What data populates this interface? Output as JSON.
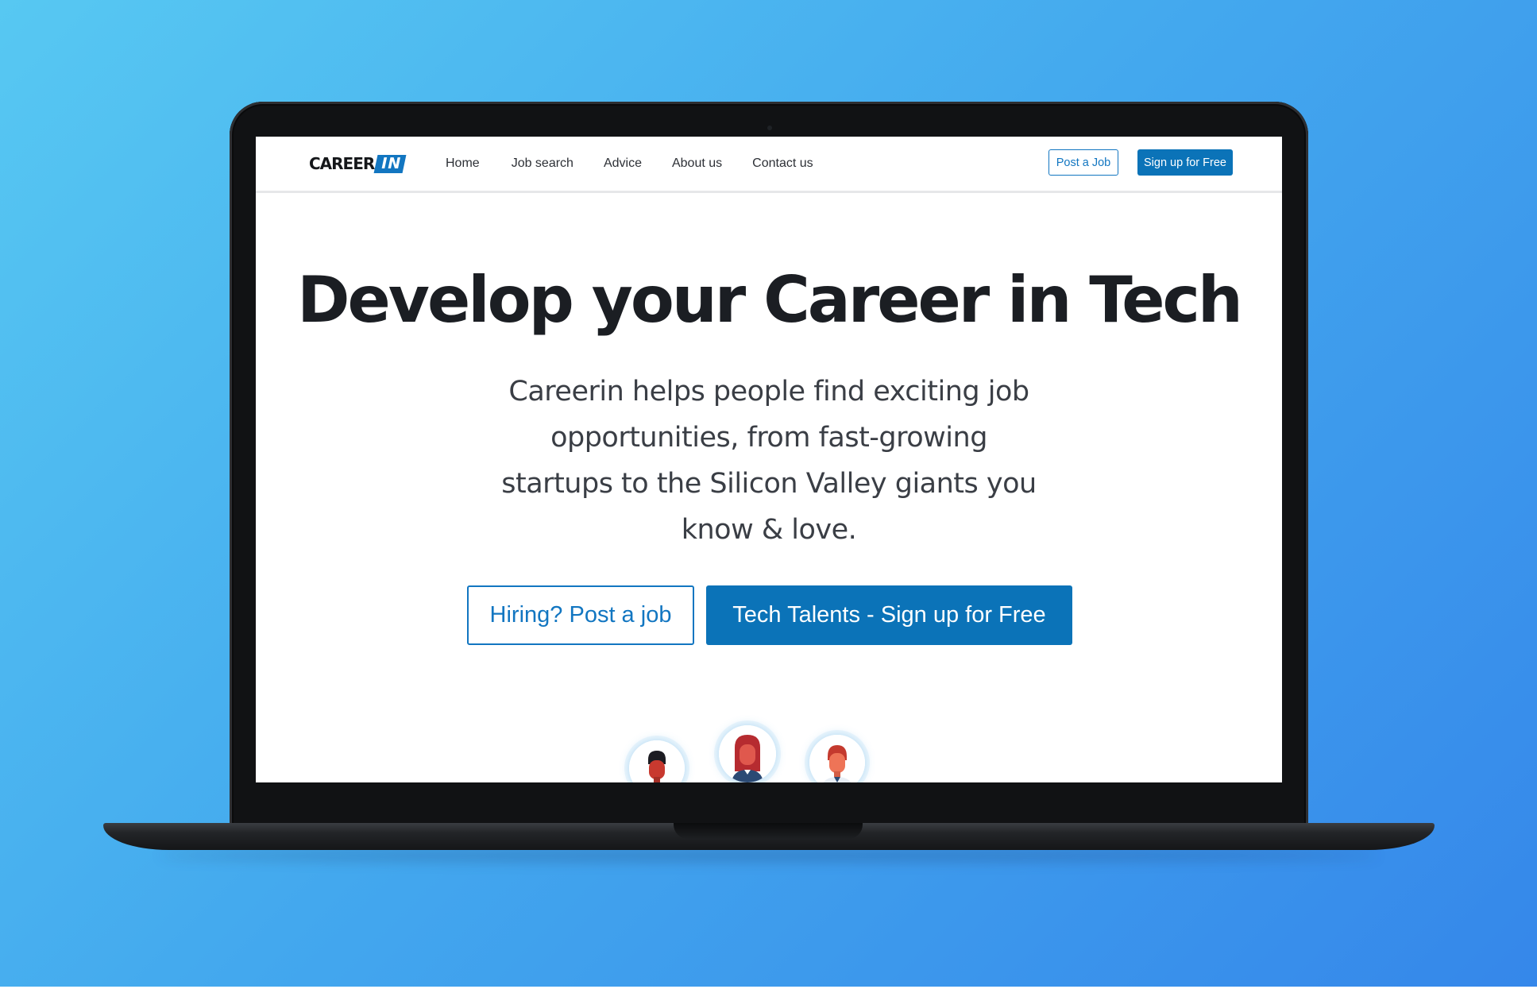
{
  "nav": {
    "logo_text": "CAREER",
    "logo_badge": "IN",
    "links": [
      "Home",
      "Job search",
      "Advice",
      "About us",
      "Contact us"
    ],
    "post_job_label": "Post a Job",
    "signup_label": "Sign up for Free"
  },
  "hero": {
    "title": "Develop your Career in Tech",
    "subtitle": "Careerin helps people find exciting job opportunities, from fast-growing startups to the Silicon Valley giants you know & love.",
    "cta_hiring_label": "Hiring? Post a job",
    "cta_talent_label": "Tech Talents - Sign up for Free"
  },
  "avatars": [
    {
      "icon": "man-avatar-icon"
    },
    {
      "icon": "woman-avatar-icon"
    },
    {
      "icon": "man-redhead-avatar-icon"
    }
  ],
  "colors": {
    "brand": "#0b73b8",
    "heading": "#1b1e23",
    "background_gradient_start": "#57c8f2",
    "background_gradient_end": "#3587ea"
  }
}
